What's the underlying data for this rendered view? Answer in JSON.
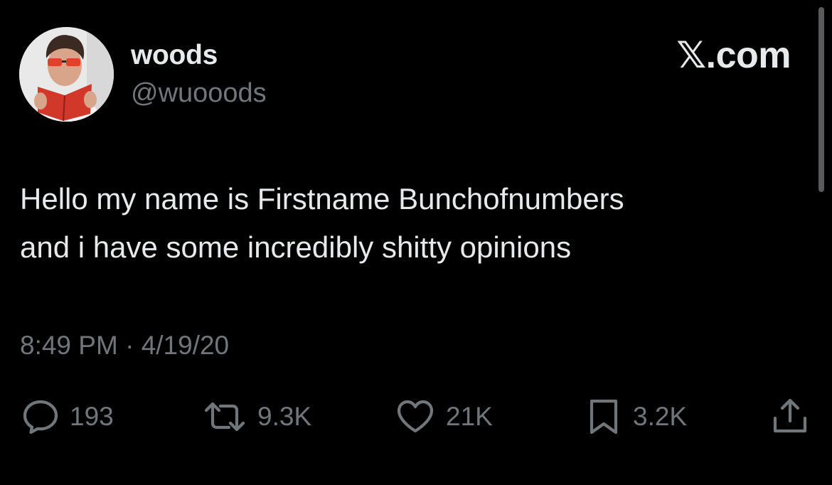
{
  "user": {
    "display_name": "woods",
    "handle": "@wuooods"
  },
  "brand": {
    "text": "X.com",
    "x_glyph": "𝕏",
    "suffix": ".com"
  },
  "tweet": {
    "lines": [
      "Hello my name is Firstname Bunchofnumbers",
      "and i have some incredibly shitty opinions"
    ],
    "time": "8:49 PM",
    "separator": "·",
    "date": "4/19/20"
  },
  "actions": {
    "reply": {
      "icon": "reply-icon",
      "count": "193"
    },
    "repost": {
      "icon": "repost-icon",
      "count": "9.3K"
    },
    "like": {
      "icon": "heart-icon",
      "count": "21K"
    },
    "bookmark": {
      "icon": "bookmark-icon",
      "count": "3.2K"
    },
    "share": {
      "icon": "share-icon"
    }
  },
  "colors": {
    "background": "#000000",
    "primary_text": "#e7e9ea",
    "secondary_text": "#71767b"
  }
}
